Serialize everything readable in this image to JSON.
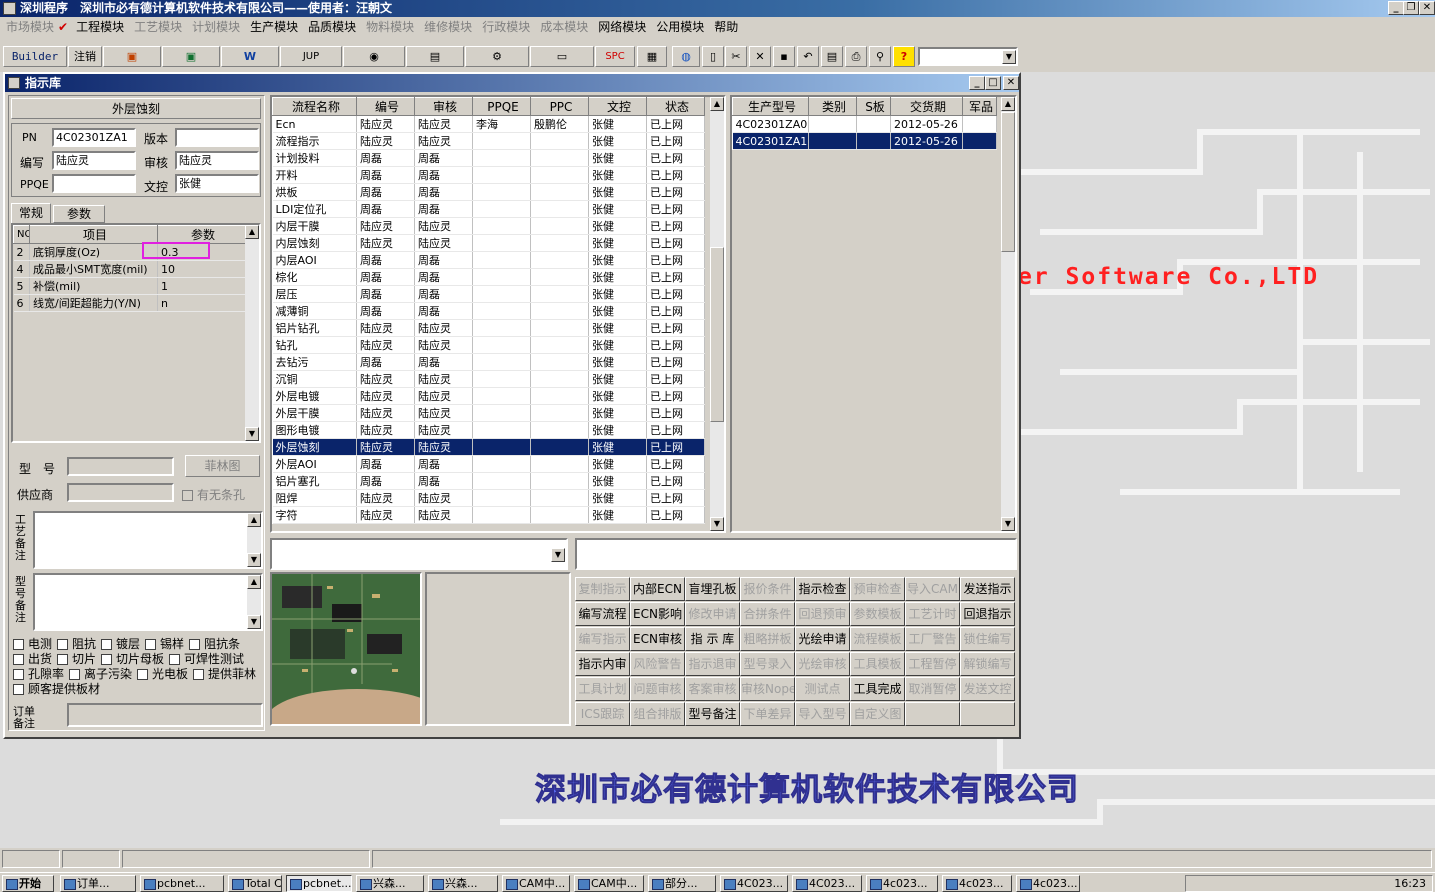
{
  "app": {
    "title": "深圳程序　深圳市必有德计算机软件技术有限公司——使用者：汪朝文"
  },
  "menu": [
    "市场模块",
    "工程模块",
    "工艺模块",
    "计划模块",
    "生产模块",
    "品质模块",
    "物料模块",
    "维修模块",
    "行政模块",
    "成本模块",
    "网络模块",
    "公用模块",
    "帮助"
  ],
  "toolbar": {
    "builder": "Builder",
    "logout": "注销",
    "jup": "JUP",
    "spc": "SPC"
  },
  "background": {
    "en_text": "er Software Co.,LTD",
    "cn_text": "深圳市必有德计算机软件技术有限公司"
  },
  "window": {
    "title": "指示库"
  },
  "left": {
    "header": "外层蚀刻",
    "pn_label": "PN",
    "pn_value": "4C02301ZA1",
    "version_label": "版本",
    "version_value": "",
    "author_label": "编写",
    "author_value": "陆应灵",
    "review_label": "审核",
    "review_value": "陆应灵",
    "ppqe_label": "PPQE",
    "ppqe_value": "",
    "doc_label": "文控",
    "doc_value": "张健",
    "tabs": [
      "常规",
      "参数"
    ],
    "param_cols": [
      "NO",
      "项目",
      "参数"
    ],
    "params": [
      {
        "no": "2",
        "item": "底铜厚度(Oz)",
        "value": "0.3"
      },
      {
        "no": "4",
        "item": "成品最小SMT宽度(mil)",
        "value": "10"
      },
      {
        "no": "5",
        "item": "补偿(mil)",
        "value": "1"
      },
      {
        "no": "6",
        "item": "线宽/间距超能力(Y/N)",
        "value": "n"
      }
    ],
    "model_label": "型　号",
    "feilin_btn": "菲林图",
    "supplier_label": "供应商",
    "slot_label": "有无条孔",
    "craft_note": "工艺备注",
    "model_note": "型号备注",
    "checks": [
      [
        "电测",
        "阻抗",
        "镀层",
        "锡样",
        "阻抗条"
      ],
      [
        "出货",
        "切片",
        "切片母板",
        "可焊性测试"
      ],
      [
        "孔隙率",
        "离子污染",
        "光电板",
        "提供菲林"
      ],
      [
        "顾客提供板材"
      ]
    ],
    "order_note": "订单备注"
  },
  "flow": {
    "cols": [
      "流程名称",
      "编号",
      "审核",
      "PPQE",
      "PPC",
      "文控",
      "状态"
    ],
    "rows": [
      [
        "Ecn",
        "陆应灵",
        "陆应灵",
        "李海",
        "殷鹏伦",
        "张健",
        "已上网"
      ],
      [
        "流程指示",
        "陆应灵",
        "陆应灵",
        "",
        "",
        "张健",
        "已上网"
      ],
      [
        "计划投料",
        "周磊",
        "周磊",
        "",
        "",
        "张健",
        "已上网"
      ],
      [
        "开料",
        "周磊",
        "周磊",
        "",
        "",
        "张健",
        "已上网"
      ],
      [
        "烘板",
        "周磊",
        "周磊",
        "",
        "",
        "张健",
        "已上网"
      ],
      [
        "LDI定位孔",
        "周磊",
        "周磊",
        "",
        "",
        "张健",
        "已上网"
      ],
      [
        "内层干膜",
        "陆应灵",
        "陆应灵",
        "",
        "",
        "张健",
        "已上网"
      ],
      [
        "内层蚀刻",
        "陆应灵",
        "陆应灵",
        "",
        "",
        "张健",
        "已上网"
      ],
      [
        "内层AOI",
        "周磊",
        "周磊",
        "",
        "",
        "张健",
        "已上网"
      ],
      [
        "棕化",
        "周磊",
        "周磊",
        "",
        "",
        "张健",
        "已上网"
      ],
      [
        "层压",
        "周磊",
        "周磊",
        "",
        "",
        "张健",
        "已上网"
      ],
      [
        "减薄铜",
        "周磊",
        "周磊",
        "",
        "",
        "张健",
        "已上网"
      ],
      [
        "铝片钻孔",
        "陆应灵",
        "陆应灵",
        "",
        "",
        "张健",
        "已上网"
      ],
      [
        "钻孔",
        "陆应灵",
        "陆应灵",
        "",
        "",
        "张健",
        "已上网"
      ],
      [
        "去钻污",
        "周磊",
        "周磊",
        "",
        "",
        "张健",
        "已上网"
      ],
      [
        "沉铜",
        "陆应灵",
        "陆应灵",
        "",
        "",
        "张健",
        "已上网"
      ],
      [
        "外层电镀",
        "陆应灵",
        "陆应灵",
        "",
        "",
        "张健",
        "已上网"
      ],
      [
        "外层干膜",
        "陆应灵",
        "陆应灵",
        "",
        "",
        "张健",
        "已上网"
      ],
      [
        "图形电镀",
        "陆应灵",
        "陆应灵",
        "",
        "",
        "张健",
        "已上网"
      ],
      [
        "外层蚀刻",
        "陆应灵",
        "陆应灵",
        "",
        "",
        "张健",
        "已上网"
      ],
      [
        "外层AOI",
        "周磊",
        "周磊",
        "",
        "",
        "张健",
        "已上网"
      ],
      [
        "铝片塞孔",
        "周磊",
        "周磊",
        "",
        "",
        "张健",
        "已上网"
      ],
      [
        "阻焊",
        "陆应灵",
        "陆应灵",
        "",
        "",
        "张健",
        "已上网"
      ],
      [
        "字符",
        "陆应灵",
        "陆应灵",
        "",
        "",
        "张健",
        "已上网"
      ]
    ],
    "selected": 19
  },
  "models": {
    "cols": [
      "生产型号",
      "类别",
      "S板",
      "交货期",
      "军品"
    ],
    "rows": [
      [
        "4C02301ZA0",
        "",
        "",
        "2012-05-26",
        ""
      ],
      [
        "4C02301ZA1",
        "",
        "",
        "2012-05-26",
        ""
      ]
    ],
    "selected": 1
  },
  "actions": [
    [
      [
        "复制指示",
        0
      ],
      [
        "内部ECN",
        1
      ],
      [
        "盲埋孔板",
        1
      ],
      [
        "报价条件",
        0
      ],
      [
        "指示检查",
        1
      ],
      [
        "预审检查",
        0
      ],
      [
        "导入CAM",
        0
      ],
      [
        "发送指示",
        1
      ]
    ],
    [
      [
        "编写流程",
        1
      ],
      [
        "ECN影响",
        1
      ],
      [
        "修改申请",
        0
      ],
      [
        "合拼条件",
        0
      ],
      [
        "回退预审",
        0
      ],
      [
        "参数模板",
        0
      ],
      [
        "工艺计时",
        0
      ],
      [
        "回退指示",
        1
      ]
    ],
    [
      [
        "编写指示",
        0
      ],
      [
        "ECN审核",
        1
      ],
      [
        "指 示 库",
        1
      ],
      [
        "粗略拼板",
        0
      ],
      [
        "光绘申请",
        1
      ],
      [
        "流程模板",
        0
      ],
      [
        "工厂警告",
        0
      ],
      [
        "锁住编写",
        0
      ]
    ],
    [
      [
        "指示内审",
        1
      ],
      [
        "风险警告",
        0
      ],
      [
        "指示退审",
        0
      ],
      [
        "型号录入",
        0
      ],
      [
        "光绘审核",
        0
      ],
      [
        "工具模板",
        0
      ],
      [
        "工程暂停",
        0
      ],
      [
        "解锁编写",
        0
      ]
    ],
    [
      [
        "工具计划",
        0
      ],
      [
        "问题审核",
        0
      ],
      [
        "客案审核",
        0
      ],
      [
        "审核Nope",
        0
      ],
      [
        "测试点",
        0
      ],
      [
        "工具完成",
        1
      ],
      [
        "取消暂停",
        0
      ],
      [
        "发送文控",
        0
      ]
    ],
    [
      [
        "ICS跟踪",
        0
      ],
      [
        "组合排版",
        0
      ],
      [
        "型号备注",
        1
      ],
      [
        "下单差异",
        0
      ],
      [
        "导入型号",
        0
      ],
      [
        "自定义图",
        0
      ],
      [
        "",
        0
      ],
      [
        "",
        0
      ]
    ]
  ],
  "taskbar": {
    "start": "开始",
    "items": [
      "订单...",
      "pcbnet...",
      "Total C...",
      "pcbnet...",
      "兴森...",
      "兴森...",
      "CAM中...",
      "CAM中...",
      "部分...",
      "4C023...",
      "4C023...",
      "4c023...",
      "4c023...",
      "4c023..."
    ],
    "clock": "16:23"
  },
  "colors": {
    "selection": "#0a246a",
    "highlight_box": "#e020e0",
    "bg_en": "#ff2020",
    "bg_cn": "#5a6cf0"
  }
}
